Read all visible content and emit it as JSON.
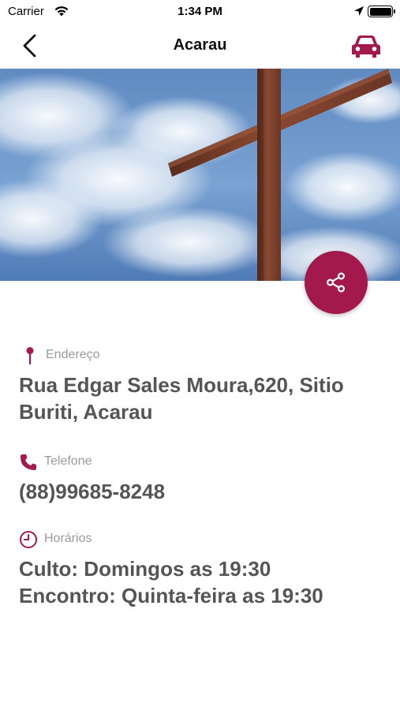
{
  "status_bar": {
    "carrier": "Carrier",
    "time": "1:34 PM"
  },
  "nav": {
    "title": "Acarau",
    "back_icon": "chevron-left-icon",
    "car_icon": "car-icon"
  },
  "hero": {
    "image": "wooden-cross-sky"
  },
  "share": {
    "icon": "share-icon"
  },
  "address": {
    "label": "Endereço",
    "value": "Rua Edgar Sales Moura,620, Sitio Buriti, Acarau",
    "icon": "pin-icon"
  },
  "phone": {
    "label": "Telefone",
    "value": "(88)99685-8248",
    "icon": "phone-icon"
  },
  "hours": {
    "label": "Horários",
    "lines": [
      "Culto: Domingos as 19:30",
      "Encontro: Quinta-feira as 19:30"
    ],
    "icon": "clock-icon"
  },
  "colors": {
    "accent": "#a3194b",
    "label_gray": "#9a9a9a",
    "value_gray": "#555555"
  }
}
